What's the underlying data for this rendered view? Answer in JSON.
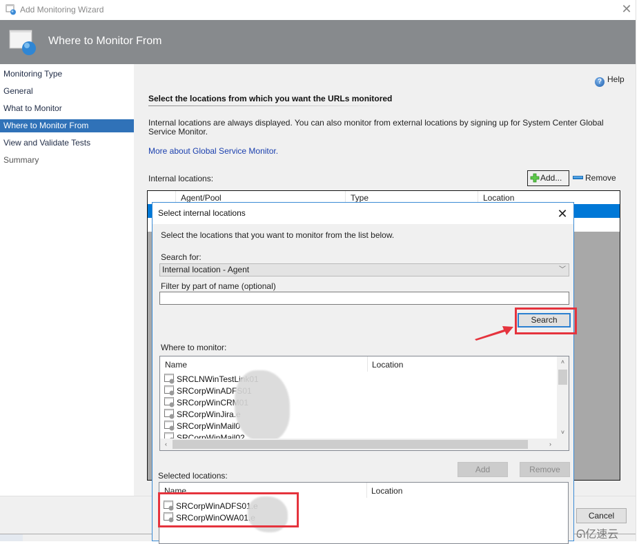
{
  "window": {
    "title": "Add Monitoring Wizard",
    "close_glyph": "✕"
  },
  "banner": {
    "title": "Where to Monitor From"
  },
  "nav": {
    "items": [
      {
        "label": "Monitoring Type",
        "state": "normal"
      },
      {
        "label": "General",
        "state": "normal"
      },
      {
        "label": "What to Monitor",
        "state": "normal"
      },
      {
        "label": "Where to Monitor From",
        "state": "active"
      },
      {
        "label": "View and Validate Tests",
        "state": "normal"
      },
      {
        "label": "Summary",
        "state": "muted"
      }
    ]
  },
  "main": {
    "help_label": "Help",
    "help_icon_glyph": "?",
    "heading": "Select the locations from which you want the URLs monitored",
    "description": "Internal locations are always displayed. You can also monitor from external locations by signing up for System Center Global Service Monitor.",
    "link": "More about Global Service Monitor.",
    "internal_label": "Internal locations:",
    "add_button": "Add...",
    "remove_button": "Remove",
    "table": {
      "columns": [
        "Agent/Pool",
        "Type",
        "Location"
      ]
    },
    "cancel_button": "Cancel"
  },
  "dialog": {
    "title": "Select internal locations",
    "close_glyph": "✕",
    "instruction": "Select the locations that you want to monitor from the list below.",
    "search_for_label": "Search for:",
    "search_for_value": "Internal location - Agent",
    "chevron_glyph": "﹀",
    "filter_label": "Filter by part of name (optional)",
    "filter_value": "",
    "search_button": "Search",
    "where_label": "Where to monitor:",
    "where_columns": [
      "Name",
      "Location"
    ],
    "where_rows": [
      {
        "name": "SRCLNWinTestLink01",
        "location": ""
      },
      {
        "name": "SRCorpWinADFS01",
        "location": ""
      },
      {
        "name": "SRCorpWinCRM01",
        "location": ""
      },
      {
        "name": "SRCorpWinJira.e",
        "location": ""
      },
      {
        "name": "SRCorpWinMail0",
        "location": ""
      },
      {
        "name": "SRCorpWinMail02",
        "location": ""
      }
    ],
    "add_button": "Add",
    "remove_button": "Remove",
    "selected_label": "Selected locations:",
    "selected_columns": [
      "Name",
      "Location"
    ],
    "selected_rows": [
      {
        "name": "SRCorpWinADFS01.e",
        "location": ""
      },
      {
        "name": "SRCorpWinOWA01.e",
        "location": ""
      }
    ],
    "scroll_up": "˄",
    "scroll_down": "˅",
    "scroll_left": "‹",
    "scroll_right": "›"
  },
  "annotations": {
    "highlight_color": "#e5333d"
  },
  "watermark": "亿速云",
  "colors": {
    "banner": "#878a8d",
    "nav_active": "#3072b8",
    "selection": "#0078d7",
    "link": "#1a3fae",
    "dialog_border": "#3a8ad4"
  }
}
